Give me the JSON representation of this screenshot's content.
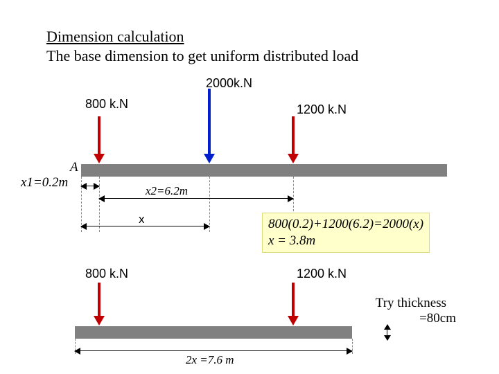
{
  "heading": {
    "title": "Dimension calculation",
    "subtitle": "The base dimension to get uniform distributed load"
  },
  "loads": {
    "center": "2000k.N",
    "left": "800 k.N",
    "right": "1200 k.N"
  },
  "dims": {
    "pointA": "A",
    "x1": "x1=0.2m",
    "x2": "x2=6.2m",
    "xbar": "x",
    "twoX": "2x =7.6 m"
  },
  "equation": {
    "line1": "800(0.2)+1200(6.2)=2000(x)",
    "line2": "x = 3.8m"
  },
  "thickness": {
    "hint": "Try thickness",
    "value": "=80cm"
  },
  "chart_data": {
    "type": "diagram",
    "title": "Combined footing moment-taking for uniform soil pressure",
    "loads_kN": {
      "left_column": 800,
      "right_column": 1200,
      "resultant": 2000
    },
    "offsets_m": {
      "x1_from_A_to_left_column": 0.2,
      "x2_left_to_right_column": 6.2
    },
    "equation": "800*0.2 + 1200*6.2 = 2000*x",
    "solved_x_m": 3.8,
    "footing_length_m": 7.6,
    "try_thickness_cm": 80
  }
}
